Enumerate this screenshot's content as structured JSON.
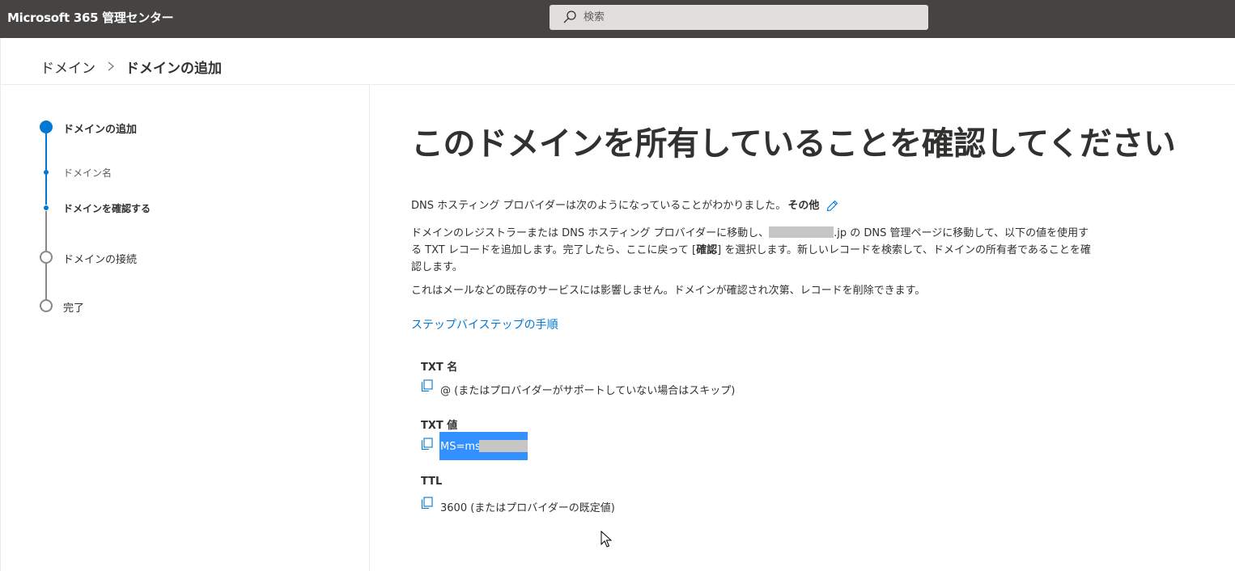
{
  "header": {
    "app_title": "Microsoft 365 管理センター",
    "search_placeholder": "検索"
  },
  "breadcrumb": {
    "parent": "ドメイン",
    "current": "ドメインの追加"
  },
  "stepper": {
    "steps": [
      {
        "label": "ドメインの追加",
        "state": "active"
      },
      {
        "label": "ドメイン名",
        "state": "completed-sub"
      },
      {
        "label": "ドメインを確認する",
        "state": "current-sub"
      },
      {
        "label": "ドメインの接続",
        "state": "pending"
      },
      {
        "label": "完了",
        "state": "pending"
      }
    ]
  },
  "main": {
    "title": "このドメインを所有していることを確認してください",
    "provider_text": "DNS ホスティング プロバイダーは次のようになっていることがわかりました。",
    "provider_name": "その他",
    "instruction_part1": "ドメインのレジストラーまたは DNS ホスティング プロバイダーに移動し、",
    "instruction_part2": ".jp の DNS 管理ページに移動して、以下の値を使用する TXT レコードを追加します。完了したら、ここに戻って [",
    "instruction_bold": "確認",
    "instruction_part3": "] を選択します。新しいレコードを検索して、ドメインの所有者であることを確認します。",
    "note": "これはメールなどの既存のサービスには影響しません。ドメインが確認され次第、レコードを削除できます。",
    "step_link": "ステップバイステップの手順",
    "fields": {
      "txt_name_label": "TXT 名",
      "txt_name_value": "@ (またはプロバイダーがサポートしていない場合はスキップ)",
      "txt_value_label": "TXT 値",
      "txt_value_value": "MS=ms",
      "ttl_label": "TTL",
      "ttl_value": "3600 (またはプロバイダーの既定値)"
    }
  },
  "colors": {
    "topbar": "#464442",
    "accent": "#0078d4",
    "selection": "#3391ff"
  },
  "icons": [
    "search-icon",
    "chevron-right-icon",
    "pencil-icon",
    "copy-icon",
    "mouse-cursor-icon"
  ]
}
